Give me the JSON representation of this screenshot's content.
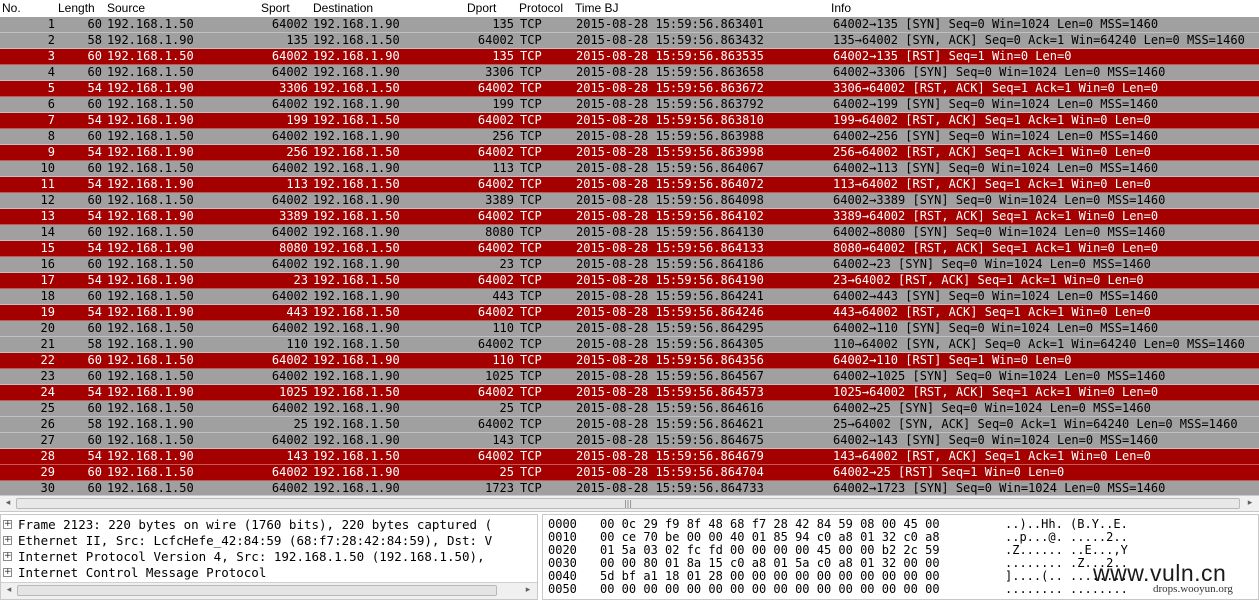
{
  "columns": {
    "no": "No.",
    "length": "Length",
    "source": "Source",
    "sport": "Sport",
    "destination": "Destination",
    "dport": "Dport",
    "protocol": "Protocol",
    "time": "Time BJ",
    "info": "Info"
  },
  "colors": {
    "syn_row_bg": "#a0a0a0",
    "syn_row_fg": "#000000",
    "rst_row_bg": "#a40000",
    "rst_row_fg": "#ffffff"
  },
  "packets": [
    {
      "no": "1",
      "len": "60",
      "src": "192.168.1.50",
      "sport": "64002",
      "dst": "192.168.1.90",
      "dport": "135",
      "proto": "TCP",
      "time": "2015-08-28  15:59:56.863401",
      "info": "64002→135 [SYN] Seq=0 Win=1024 Len=0 MSS=1460",
      "kind": "syn"
    },
    {
      "no": "2",
      "len": "58",
      "src": "192.168.1.90",
      "sport": "135",
      "dst": "192.168.1.50",
      "dport": "64002",
      "proto": "TCP",
      "time": "2015-08-28  15:59:56.863432",
      "info": "135→64002 [SYN, ACK] Seq=0 Ack=1 Win=64240 Len=0 MSS=1460",
      "kind": "syn"
    },
    {
      "no": "3",
      "len": "60",
      "src": "192.168.1.50",
      "sport": "64002",
      "dst": "192.168.1.90",
      "dport": "135",
      "proto": "TCP",
      "time": "2015-08-28  15:59:56.863535",
      "info": "64002→135 [RST] Seq=1 Win=0 Len=0",
      "kind": "rst"
    },
    {
      "no": "4",
      "len": "60",
      "src": "192.168.1.50",
      "sport": "64002",
      "dst": "192.168.1.90",
      "dport": "3306",
      "proto": "TCP",
      "time": "2015-08-28  15:59:56.863658",
      "info": "64002→3306 [SYN] Seq=0 Win=1024 Len=0 MSS=1460",
      "kind": "syn"
    },
    {
      "no": "5",
      "len": "54",
      "src": "192.168.1.90",
      "sport": "3306",
      "dst": "192.168.1.50",
      "dport": "64002",
      "proto": "TCP",
      "time": "2015-08-28  15:59:56.863672",
      "info": "3306→64002 [RST, ACK] Seq=1 Ack=1 Win=0 Len=0",
      "kind": "rst"
    },
    {
      "no": "6",
      "len": "60",
      "src": "192.168.1.50",
      "sport": "64002",
      "dst": "192.168.1.90",
      "dport": "199",
      "proto": "TCP",
      "time": "2015-08-28  15:59:56.863792",
      "info": "64002→199 [SYN] Seq=0 Win=1024 Len=0 MSS=1460",
      "kind": "syn"
    },
    {
      "no": "7",
      "len": "54",
      "src": "192.168.1.90",
      "sport": "199",
      "dst": "192.168.1.50",
      "dport": "64002",
      "proto": "TCP",
      "time": "2015-08-28  15:59:56.863810",
      "info": "199→64002 [RST, ACK] Seq=1 Ack=1 Win=0 Len=0",
      "kind": "rst"
    },
    {
      "no": "8",
      "len": "60",
      "src": "192.168.1.50",
      "sport": "64002",
      "dst": "192.168.1.90",
      "dport": "256",
      "proto": "TCP",
      "time": "2015-08-28  15:59:56.863988",
      "info": "64002→256 [SYN] Seq=0 Win=1024 Len=0 MSS=1460",
      "kind": "syn"
    },
    {
      "no": "9",
      "len": "54",
      "src": "192.168.1.90",
      "sport": "256",
      "dst": "192.168.1.50",
      "dport": "64002",
      "proto": "TCP",
      "time": "2015-08-28  15:59:56.863998",
      "info": "256→64002 [RST, ACK] Seq=1 Ack=1 Win=0 Len=0",
      "kind": "rst"
    },
    {
      "no": "10",
      "len": "60",
      "src": "192.168.1.50",
      "sport": "64002",
      "dst": "192.168.1.90",
      "dport": "113",
      "proto": "TCP",
      "time": "2015-08-28  15:59:56.864067",
      "info": "64002→113 [SYN] Seq=0 Win=1024 Len=0 MSS=1460",
      "kind": "syn"
    },
    {
      "no": "11",
      "len": "54",
      "src": "192.168.1.90",
      "sport": "113",
      "dst": "192.168.1.50",
      "dport": "64002",
      "proto": "TCP",
      "time": "2015-08-28  15:59:56.864072",
      "info": "113→64002 [RST, ACK] Seq=1 Ack=1 Win=0 Len=0",
      "kind": "rst"
    },
    {
      "no": "12",
      "len": "60",
      "src": "192.168.1.50",
      "sport": "64002",
      "dst": "192.168.1.90",
      "dport": "3389",
      "proto": "TCP",
      "time": "2015-08-28  15:59:56.864098",
      "info": "64002→3389 [SYN] Seq=0 Win=1024 Len=0 MSS=1460",
      "kind": "syn"
    },
    {
      "no": "13",
      "len": "54",
      "src": "192.168.1.90",
      "sport": "3389",
      "dst": "192.168.1.50",
      "dport": "64002",
      "proto": "TCP",
      "time": "2015-08-28  15:59:56.864102",
      "info": "3389→64002 [RST, ACK] Seq=1 Ack=1 Win=0 Len=0",
      "kind": "rst"
    },
    {
      "no": "14",
      "len": "60",
      "src": "192.168.1.50",
      "sport": "64002",
      "dst": "192.168.1.90",
      "dport": "8080",
      "proto": "TCP",
      "time": "2015-08-28  15:59:56.864130",
      "info": "64002→8080 [SYN] Seq=0 Win=1024 Len=0 MSS=1460",
      "kind": "syn"
    },
    {
      "no": "15",
      "len": "54",
      "src": "192.168.1.90",
      "sport": "8080",
      "dst": "192.168.1.50",
      "dport": "64002",
      "proto": "TCP",
      "time": "2015-08-28  15:59:56.864133",
      "info": "8080→64002 [RST, ACK] Seq=1 Ack=1 Win=0 Len=0",
      "kind": "rst"
    },
    {
      "no": "16",
      "len": "60",
      "src": "192.168.1.50",
      "sport": "64002",
      "dst": "192.168.1.90",
      "dport": "23",
      "proto": "TCP",
      "time": "2015-08-28  15:59:56.864186",
      "info": "64002→23 [SYN] Seq=0 Win=1024 Len=0 MSS=1460",
      "kind": "syn"
    },
    {
      "no": "17",
      "len": "54",
      "src": "192.168.1.90",
      "sport": "23",
      "dst": "192.168.1.50",
      "dport": "64002",
      "proto": "TCP",
      "time": "2015-08-28  15:59:56.864190",
      "info": "23→64002 [RST, ACK] Seq=1 Ack=1 Win=0 Len=0",
      "kind": "rst"
    },
    {
      "no": "18",
      "len": "60",
      "src": "192.168.1.50",
      "sport": "64002",
      "dst": "192.168.1.90",
      "dport": "443",
      "proto": "TCP",
      "time": "2015-08-28  15:59:56.864241",
      "info": "64002→443 [SYN] Seq=0 Win=1024 Len=0 MSS=1460",
      "kind": "syn"
    },
    {
      "no": "19",
      "len": "54",
      "src": "192.168.1.90",
      "sport": "443",
      "dst": "192.168.1.50",
      "dport": "64002",
      "proto": "TCP",
      "time": "2015-08-28  15:59:56.864246",
      "info": "443→64002 [RST, ACK] Seq=1 Ack=1 Win=0 Len=0",
      "kind": "rst"
    },
    {
      "no": "20",
      "len": "60",
      "src": "192.168.1.50",
      "sport": "64002",
      "dst": "192.168.1.90",
      "dport": "110",
      "proto": "TCP",
      "time": "2015-08-28  15:59:56.864295",
      "info": "64002→110 [SYN] Seq=0 Win=1024 Len=0 MSS=1460",
      "kind": "syn"
    },
    {
      "no": "21",
      "len": "58",
      "src": "192.168.1.90",
      "sport": "110",
      "dst": "192.168.1.50",
      "dport": "64002",
      "proto": "TCP",
      "time": "2015-08-28  15:59:56.864305",
      "info": "110→64002 [SYN, ACK] Seq=0 Ack=1 Win=64240 Len=0 MSS=1460",
      "kind": "syn"
    },
    {
      "no": "22",
      "len": "60",
      "src": "192.168.1.50",
      "sport": "64002",
      "dst": "192.168.1.90",
      "dport": "110",
      "proto": "TCP",
      "time": "2015-08-28  15:59:56.864356",
      "info": "64002→110 [RST] Seq=1 Win=0 Len=0",
      "kind": "rst"
    },
    {
      "no": "23",
      "len": "60",
      "src": "192.168.1.50",
      "sport": "64002",
      "dst": "192.168.1.90",
      "dport": "1025",
      "proto": "TCP",
      "time": "2015-08-28  15:59:56.864567",
      "info": "64002→1025 [SYN] Seq=0 Win=1024 Len=0 MSS=1460",
      "kind": "syn"
    },
    {
      "no": "24",
      "len": "54",
      "src": "192.168.1.90",
      "sport": "1025",
      "dst": "192.168.1.50",
      "dport": "64002",
      "proto": "TCP",
      "time": "2015-08-28  15:59:56.864573",
      "info": "1025→64002 [RST, ACK] Seq=1 Ack=1 Win=0 Len=0",
      "kind": "rst"
    },
    {
      "no": "25",
      "len": "60",
      "src": "192.168.1.50",
      "sport": "64002",
      "dst": "192.168.1.90",
      "dport": "25",
      "proto": "TCP",
      "time": "2015-08-28  15:59:56.864616",
      "info": "64002→25 [SYN] Seq=0 Win=1024 Len=0 MSS=1460",
      "kind": "syn"
    },
    {
      "no": "26",
      "len": "58",
      "src": "192.168.1.90",
      "sport": "25",
      "dst": "192.168.1.50",
      "dport": "64002",
      "proto": "TCP",
      "time": "2015-08-28  15:59:56.864621",
      "info": "25→64002 [SYN, ACK] Seq=0 Ack=1 Win=64240 Len=0 MSS=1460",
      "kind": "syn"
    },
    {
      "no": "27",
      "len": "60",
      "src": "192.168.1.50",
      "sport": "64002",
      "dst": "192.168.1.90",
      "dport": "143",
      "proto": "TCP",
      "time": "2015-08-28  15:59:56.864675",
      "info": "64002→143 [SYN] Seq=0 Win=1024 Len=0 MSS=1460",
      "kind": "syn"
    },
    {
      "no": "28",
      "len": "54",
      "src": "192.168.1.90",
      "sport": "143",
      "dst": "192.168.1.50",
      "dport": "64002",
      "proto": "TCP",
      "time": "2015-08-28  15:59:56.864679",
      "info": "143→64002 [RST, ACK] Seq=1 Ack=1 Win=0 Len=0",
      "kind": "rst"
    },
    {
      "no": "29",
      "len": "60",
      "src": "192.168.1.50",
      "sport": "64002",
      "dst": "192.168.1.90",
      "dport": "25",
      "proto": "TCP",
      "time": "2015-08-28  15:59:56.864704",
      "info": "64002→25 [RST] Seq=1 Win=0 Len=0",
      "kind": "rst"
    },
    {
      "no": "30",
      "len": "60",
      "src": "192.168.1.50",
      "sport": "64002",
      "dst": "192.168.1.90",
      "dport": "1723",
      "proto": "TCP",
      "time": "2015-08-28  15:59:56.864733",
      "info": "64002→1723 [SYN] Seq=0 Win=1024 Len=0 MSS=1460",
      "kind": "syn"
    }
  ],
  "details": [
    "Frame 2123: 220 bytes on wire (1760 bits), 220 bytes captured (",
    "Ethernet II, Src: LcfcHefe_42:84:59 (68:f7:28:42:84:59), Dst: V",
    "Internet Protocol Version 4, Src: 192.168.1.50 (192.168.1.50),",
    "Internet Control Message Protocol"
  ],
  "details_expander": "+",
  "bytes": [
    {
      "off": "0000",
      "hex": "00 0c 29 f9 8f 48 68 f7   28 42 84 59 08 00 45 00",
      "ascii": "..)..Hh. (B.Y..E."
    },
    {
      "off": "0010",
      "hex": "00 ce 70 be 00 00 40 01   85 94 c0 a8 01 32 c0 a8",
      "ascii": "..p...@. .....2.."
    },
    {
      "off": "0020",
      "hex": "01 5a 03 02 fc fd 00 00   00 00 45 00 00 b2 2c 59",
      "ascii": ".Z...... ..E...,Y"
    },
    {
      "off": "0030",
      "hex": "00 00 80 01 8a 15 c0 a8   01 5a c0 a8 01 32 00 00",
      "ascii": "........ .Z...2.."
    },
    {
      "off": "0040",
      "hex": "5d bf a1 18 01 28 00 00   00 00 00 00 00 00 00 00",
      "ascii": "]....(.. ........"
    },
    {
      "off": "0050",
      "hex": "00 00 00 00 00 00 00 00   00 00 00 00 00 00 00 00",
      "ascii": "........ ........"
    }
  ],
  "scrollbar": {
    "left_arrow": "◂",
    "right_arrow": "▸",
    "grip": "|||"
  },
  "watermark": {
    "main": "www.vuln.cn",
    "sub": "drops.wooyun.org"
  }
}
